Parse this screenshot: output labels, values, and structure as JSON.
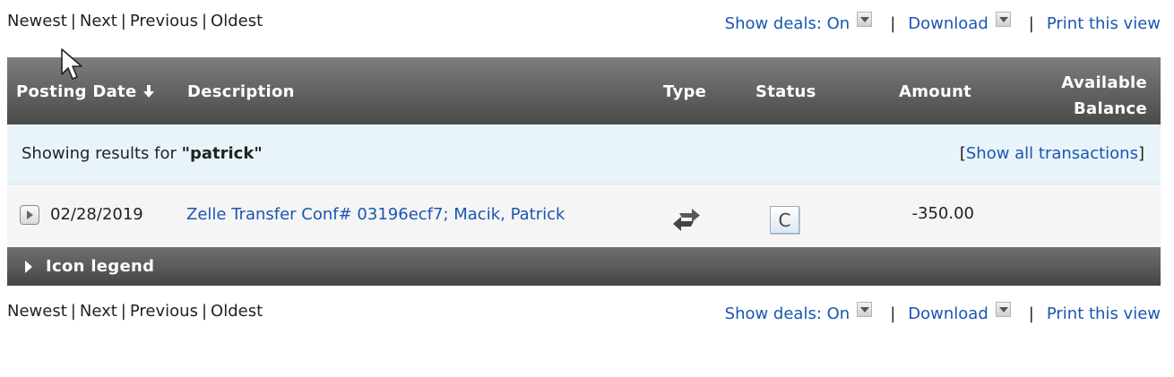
{
  "pager": {
    "newest": "Newest",
    "next": "Next",
    "previous": "Previous",
    "oldest": "Oldest",
    "sep": "|"
  },
  "tools": {
    "show_deals": "Show deals: On",
    "download": "Download",
    "print": "Print this view",
    "sep": "|"
  },
  "table": {
    "headers": {
      "posting_date": "Posting Date",
      "description": "Description",
      "type": "Type",
      "status": "Status",
      "amount": "Amount",
      "balance_line1": "Available",
      "balance_line2": "Balance"
    },
    "filter": {
      "prefix": "Showing results for ",
      "query": "\"patrick\"",
      "open_bracket": "[",
      "show_all": "Show all transactions",
      "close_bracket": "]"
    },
    "rows": [
      {
        "date": "02/28/2019",
        "description": "Zelle Transfer Conf# 03196ecf7; Macik, Patrick",
        "type_icon": "transfer-arrows-icon",
        "status": "C",
        "amount": "-350.00",
        "balance": ""
      }
    ],
    "legend": "Icon legend"
  },
  "colors": {
    "link": "#1a56b0",
    "header_bg": "#5a5a5a",
    "filter_bg": "#e9f4fa",
    "row_bg": "#f5f5f5"
  }
}
